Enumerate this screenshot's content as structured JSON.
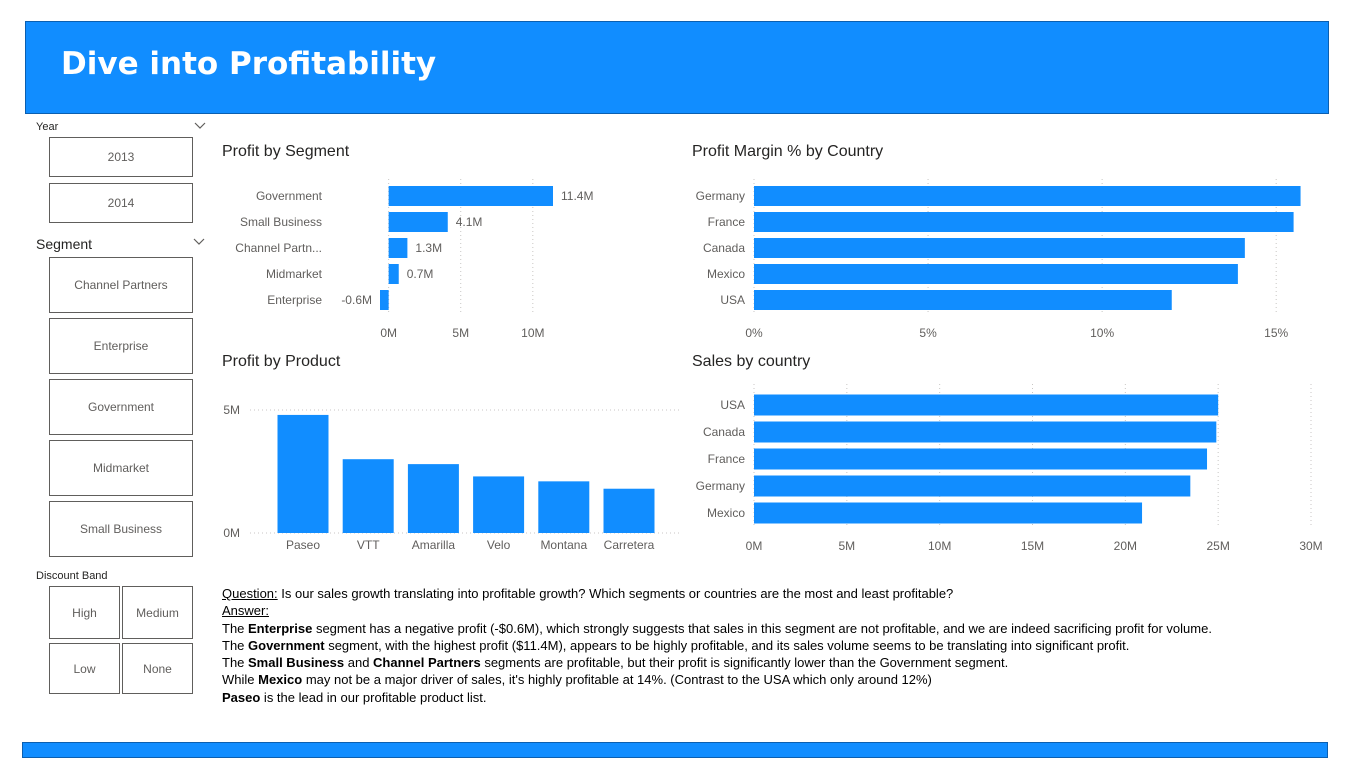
{
  "header": {
    "title": "Dive into Profitability"
  },
  "slicers": {
    "year": {
      "label": "Year",
      "items": [
        "2013",
        "2014"
      ]
    },
    "segment": {
      "label": "Segment",
      "items": [
        "Channel Partners",
        "Enterprise",
        "Government",
        "Midmarket",
        "Small Business"
      ]
    },
    "discount": {
      "label": "Discount Band",
      "items": [
        "High",
        "Medium",
        "Low",
        "None"
      ]
    }
  },
  "chart_data": [
    {
      "id": "profit_by_segment",
      "type": "bar",
      "orientation": "horizontal",
      "title": "Profit by Segment",
      "categories": [
        "Government",
        "Small Business",
        "Channel Partn...",
        "Midmarket",
        "Enterprise"
      ],
      "values": [
        11.4,
        4.1,
        1.3,
        0.7,
        -0.6
      ],
      "data_labels": [
        "11.4M",
        "4.1M",
        "1.3M",
        "0.7M",
        "-0.6M"
      ],
      "xlim": [
        -0.6,
        11.4
      ],
      "xticks": [
        0,
        5,
        10
      ],
      "xtick_labels": [
        "0M",
        "5M",
        "10M"
      ],
      "grid": true
    },
    {
      "id": "profit_margin_by_country",
      "type": "bar",
      "orientation": "horizontal",
      "title": "Profit Margin % by Country",
      "categories": [
        "Germany",
        "France",
        "Canada",
        "Mexico",
        "USA"
      ],
      "values": [
        15.7,
        15.5,
        14.1,
        13.9,
        12.0
      ],
      "xlim": [
        0,
        16
      ],
      "xticks": [
        0,
        5,
        10,
        15
      ],
      "xtick_labels": [
        "0%",
        "5%",
        "10%",
        "15%"
      ],
      "grid": true
    },
    {
      "id": "profit_by_product",
      "type": "bar",
      "orientation": "vertical",
      "title": "Profit by Product",
      "categories": [
        "Paseo",
        "VTT",
        "Amarilla",
        "Velo",
        "Montana",
        "Carretera"
      ],
      "values": [
        4.8,
        3.0,
        2.8,
        2.3,
        2.1,
        1.8
      ],
      "ylim": [
        0,
        5
      ],
      "yticks": [
        0,
        5
      ],
      "ytick_labels": [
        "0M",
        "5M"
      ],
      "grid": true
    },
    {
      "id": "sales_by_country",
      "type": "bar",
      "orientation": "horizontal",
      "title": "Sales by country",
      "categories": [
        "USA",
        "Canada",
        "France",
        "Germany",
        "Mexico"
      ],
      "values": [
        25.0,
        24.9,
        24.4,
        23.5,
        20.9
      ],
      "xlim": [
        0,
        30
      ],
      "xticks": [
        0,
        5,
        10,
        15,
        20,
        25,
        30
      ],
      "xtick_labels": [
        "0M",
        "5M",
        "10M",
        "15M",
        "20M",
        "25M",
        "30M"
      ],
      "grid": true
    }
  ],
  "qa": {
    "question_label": "Question:",
    "question_text": " Is our sales growth translating into profitable growth? Which segments or countries are the most and least profitable?",
    "answer_label": "Answer:",
    "l1a": "The ",
    "l1b": "Enterprise",
    "l1c": " segment has a negative profit (-$0.6M), which strongly suggests that sales in this segment are not profitable, and we are indeed sacrificing profit for volume.",
    "l2a": "The ",
    "l2b": "Government",
    "l2c": " segment, with the highest profit ($11.4M), appears to be highly profitable, and its sales volume seems to be translating into significant profit.",
    "l3a": "The ",
    "l3b": "Small Business",
    "l3c": " and ",
    "l3d": "Channel Partners",
    "l3e": " segments are profitable, but their profit is significantly lower than the Government segment.",
    "l4a": "While ",
    "l4b": "Mexico",
    "l4c": " may not be a major driver of sales, it's highly profitable at 14%. (Contrast to the USA which only around 12%)",
    "l5a": "Paseo",
    "l5b": " is the lead in our profitable product list."
  },
  "colors": {
    "bar": "#118DFF",
    "header": "#118DFF",
    "grid": "#c8c6c4",
    "label": "#605e5c"
  }
}
